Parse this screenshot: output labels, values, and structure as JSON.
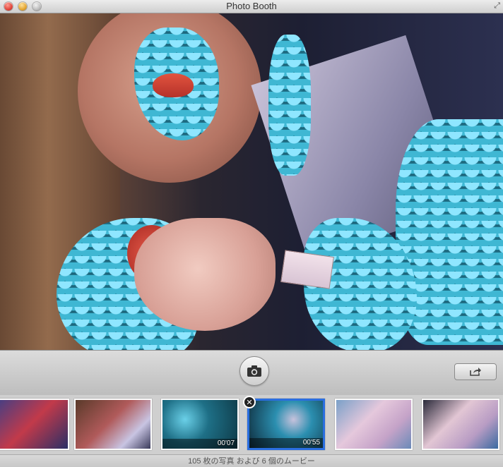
{
  "window": {
    "title": "Photo Booth"
  },
  "icons": {
    "close": "close-icon",
    "minimize": "minimize-icon",
    "zoom": "zoom-icon",
    "fullscreen": "fullscreen-icon",
    "camera": "camera-icon",
    "share": "share-icon",
    "remove": "remove-icon"
  },
  "colors": {
    "selection": "#2a6ee0"
  },
  "filmstrip": {
    "thumbnails": [
      {
        "type": "photo",
        "duration": ""
      },
      {
        "type": "photo",
        "duration": ""
      },
      {
        "type": "movie",
        "duration": "00'07"
      },
      {
        "type": "movie",
        "duration": "00'55",
        "selected": true
      },
      {
        "type": "photo",
        "duration": ""
      },
      {
        "type": "photo",
        "duration": ""
      }
    ]
  },
  "status": {
    "text": "105 枚の写真 および 6 個のムービー"
  }
}
